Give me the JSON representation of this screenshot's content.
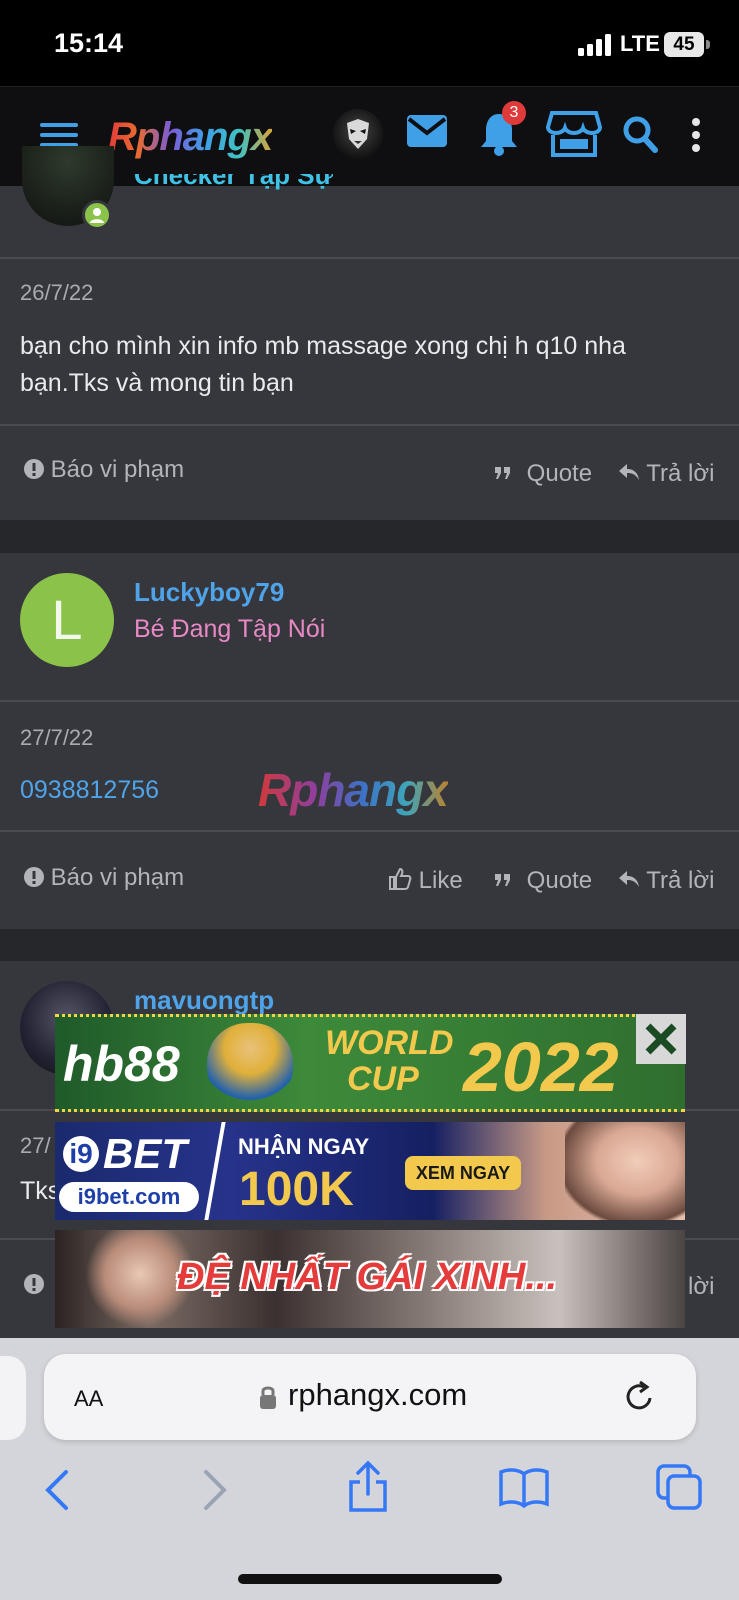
{
  "status_bar": {
    "time": "15:14",
    "network": "LTE",
    "battery": "45"
  },
  "app_bar": {
    "logo": "Rphangx",
    "notification_count": "3",
    "icons": [
      "menu-icon",
      "avatar",
      "mail-icon",
      "bell-icon",
      "store-icon",
      "search-icon",
      "more-vertical-icon"
    ],
    "colors": {
      "icon": "#3fa0e8",
      "badge": "#e03b3b",
      "background": "#0f0f11"
    }
  },
  "posts": [
    {
      "username": "Checker Tập Sự",
      "date": "26/7/22",
      "body_line1": "bạn cho mình xin info mb massage xong chị h q10 nha",
      "body_line2": "bạn.Tks và mong tin bạn",
      "report": "Báo vi phạm",
      "quote": "Quote",
      "reply": "Trả lời"
    },
    {
      "avatar_letter": "L",
      "username": "Luckyboy79",
      "user_title": "Bé Đang Tập Nói",
      "date": "27/7/22",
      "body": "0938812756",
      "watermark": "Rphangx",
      "report": "Báo vi phạm",
      "like": "Like",
      "quote": "Quote",
      "reply": "Trả lời"
    },
    {
      "username": "mavuongtp",
      "date_partial": "27/",
      "body_partial": "Tks",
      "reply_partial": "lời"
    }
  ],
  "ads": [
    {
      "brand": "hb88",
      "headline_line1": "WORLD",
      "headline_line2": "CUP",
      "year": "2022"
    },
    {
      "brand": "BET",
      "domain": "i9bet.com",
      "line1": "NHẬN NGAY",
      "amount": "100K",
      "cta": "XEM NGAY"
    },
    {
      "headline": "ĐỆ NHẤT GÁI XINH..."
    }
  ],
  "browser": {
    "text_size_label": "AA",
    "url": "rphangx.com"
  },
  "colors": {
    "page_bg": "#26272b",
    "post_bg": "#36373d",
    "link": "#4fa3e8",
    "user_title": "#e889c6",
    "avatar_green": "#8bc34a"
  }
}
